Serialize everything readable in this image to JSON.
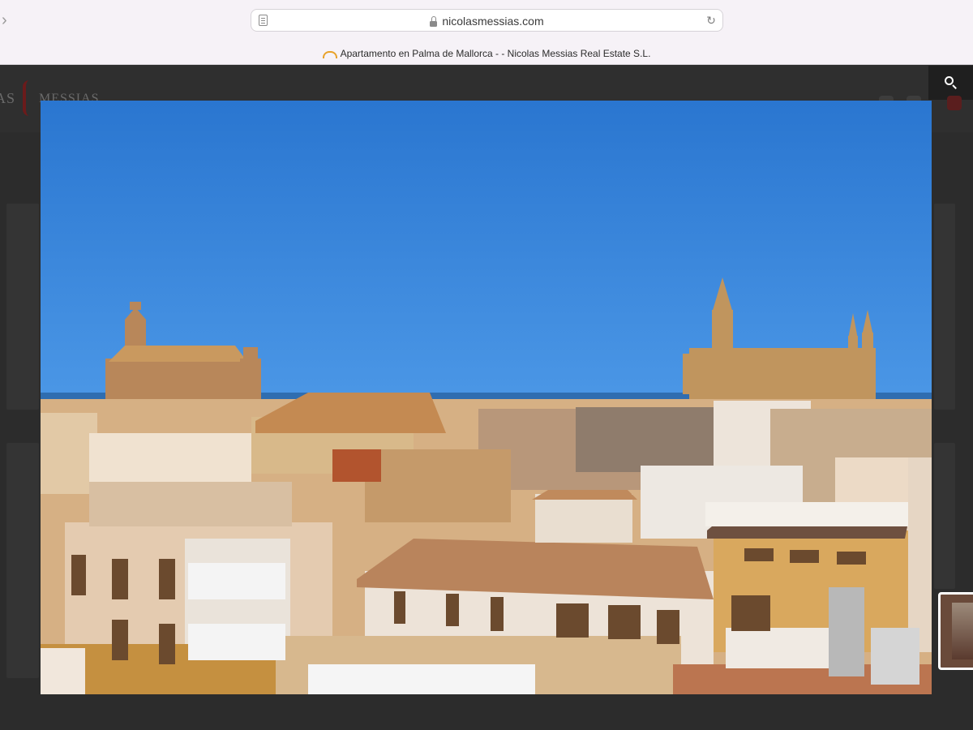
{
  "browser": {
    "url": "nicolasmessias.com",
    "tab_title": "Apartamento en Palma de Mallorca - - Nicolas Messias Real Estate S.L.",
    "icons": {
      "back": "chevron-right-icon",
      "page": "page-icon",
      "lock": "lock-icon",
      "reload": "reload-icon",
      "favicon": "favicon-icon"
    }
  },
  "site": {
    "logo_left": "AS",
    "logo_right": "MESSIAS",
    "search_icon": "search-icon",
    "accent_color": "#6b1b1b"
  },
  "lightbox": {
    "image_subject": "palma-rooftops-cathedral-photo",
    "thumbnail_icon": "thumbnail-image"
  },
  "colors": {
    "sky": "#2d7bd4",
    "chrome_bg": "#f6f2f7",
    "overlay_bg": "#2c2c2c"
  }
}
